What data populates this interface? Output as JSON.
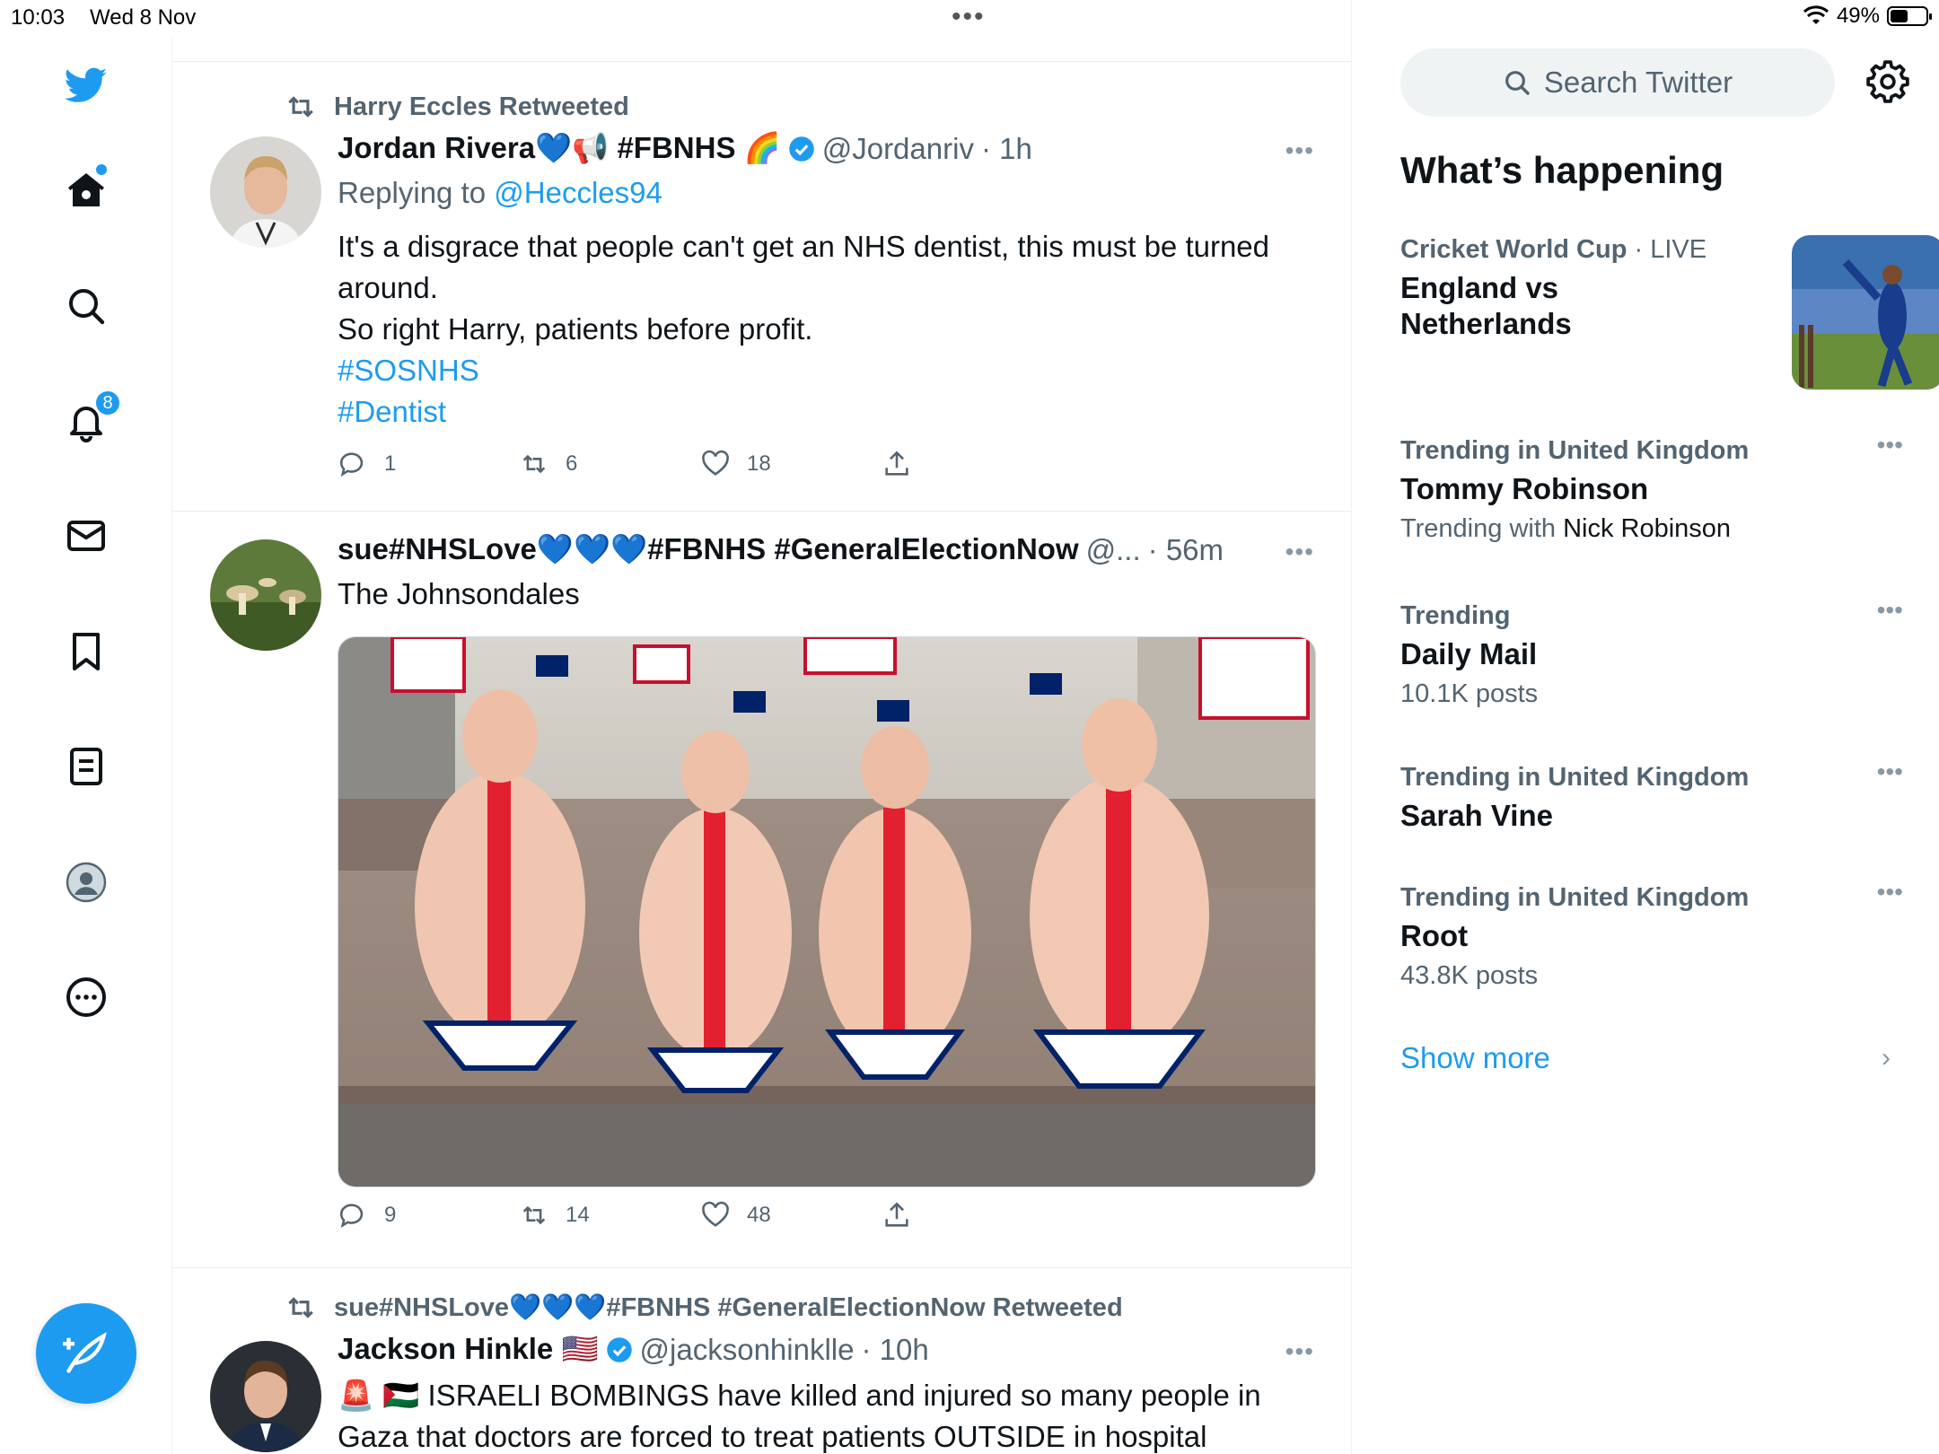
{
  "status_bar": {
    "time": "10:03",
    "date": "Wed 8 Nov",
    "battery": "49%",
    "battery_level": 0.49,
    "multitask_dots": "•••"
  },
  "nav": {
    "notifications_badge": "8"
  },
  "colors": {
    "accent": "#1d9bf0",
    "text": "#0f1419",
    "muted": "#536471"
  },
  "tweets": [
    {
      "retweet_label": "Harry Eccles Retweeted",
      "name": "Jordan Rivera💙📢 #FBNHS 🌈",
      "handle": "@Jordanriv",
      "time": "· 1h",
      "replying_prefix": "Replying to ",
      "replying_to": "@Heccles94",
      "text_lines": [
        "It's a disgrace that people can't get an NHS dentist, this must be turned",
        "around.",
        "So right Harry, patients before profit."
      ],
      "hashtags": [
        "#SOSNHS",
        "#Dentist"
      ],
      "replies": "1",
      "retweets": "6",
      "likes": "18"
    },
    {
      "name": "sue#NHSLove💙💙💙#FBNHS #GeneralElectionNow",
      "handle": "@...",
      "time": "· 56m",
      "text": "The Johnsondales",
      "replies": "9",
      "retweets": "14",
      "likes": "48"
    },
    {
      "retweet_label": "sue#NHSLove💙💙💙#FBNHS #GeneralElectionNow Retweeted",
      "name": "Jackson Hinkle 🇺🇸",
      "handle": "@jacksonhinklle",
      "time": "· 10h",
      "text_lines": [
        "🚨 🇵🇸 ISRAELI BOMBINGS have killed and injured so many people in",
        "Gaza that doctors are forced to treat patients OUTSIDE in hospital"
      ]
    }
  ],
  "sidebar": {
    "search_placeholder": "Search Twitter",
    "title": "What’s happening",
    "trends": [
      {
        "meta": "Cricket World Cup",
        "live": " · LIVE",
        "title_lines": [
          "England vs",
          "Netherlands"
        ]
      },
      {
        "meta": "Trending in United Kingdom",
        "title": "Tommy Robinson",
        "sub_prefix": "Trending with ",
        "sub_name": "Nick Robinson"
      },
      {
        "meta": "Trending",
        "title": "Daily Mail",
        "sub": "10.1K posts"
      },
      {
        "meta": "Trending in United Kingdom",
        "title": "Sarah Vine"
      },
      {
        "meta": "Trending in United Kingdom",
        "title": "Root",
        "sub": "43.8K posts"
      }
    ],
    "show_more": "Show more"
  }
}
